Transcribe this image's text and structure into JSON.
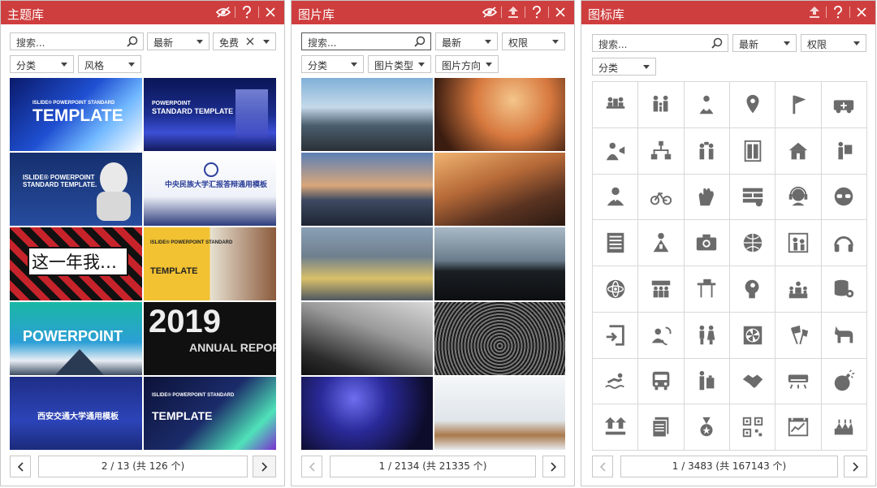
{
  "theme_panel": {
    "title": "主题库",
    "search_placeholder": "搜索...",
    "sort": "最新",
    "price": "免费",
    "category": "分类",
    "style": "风格",
    "tiles": [
      {
        "line1": "ISLIDE® POWERPOINT STANDARD",
        "line2": "TEMPLATE"
      },
      {
        "line1": "POWERPOINT",
        "line2": "STANDARD TEMPLATE"
      },
      {
        "line1": "ISLIDE® POWERPOINT",
        "line2": "STANDARD TEMPLATE."
      },
      {
        "line1": "中央民族大学汇报答辩通用模板",
        "line2": ""
      },
      {
        "line1": "这一年我…",
        "line2": ""
      },
      {
        "line1": "ISLIDE® POWERPOINT STANDARD",
        "line2": "TEMPLATE"
      },
      {
        "line1": "POWERPOINT",
        "line2": ""
      },
      {
        "line1": "2019",
        "line2": "ANNUAL REPORT"
      },
      {
        "line1": "西安交通大学通用模板",
        "line2": ""
      },
      {
        "line1": "ISLIDE® POWERPOINT STANDARD",
        "line2": "TEMPLATE"
      }
    ],
    "pager": "2 / 13 (共 126 个)"
  },
  "picture_panel": {
    "title": "图片库",
    "search_placeholder": "搜索...",
    "sort": "最新",
    "license": "权限",
    "category": "分类",
    "type": "图片类型",
    "orientation": "图片方向",
    "pager": "1 / 2134 (共 21335 个)"
  },
  "icon_panel": {
    "title": "图标库",
    "search_placeholder": "搜索...",
    "sort": "最新",
    "license": "权限",
    "category": "分类",
    "icons": [
      "meeting-icon",
      "family-icon",
      "user-target-icon",
      "location-pin-icon",
      "flag-icon",
      "ambulance-icon",
      "speaker-user-icon",
      "org-chart-icon",
      "group-talk-icon",
      "elevator-icon",
      "house-icon",
      "worker-board-icon",
      "doctor-icon",
      "bicycle-icon",
      "applause-icon",
      "brick-wall-icon",
      "support-agent-icon",
      "face-glasses-icon",
      "document-list-icon",
      "presenter-icon",
      "camera-icon",
      "globe-icon",
      "teacher-icon",
      "headphones-icon",
      "atom-icon",
      "team-icon",
      "desk-icon",
      "brain-idea-icon",
      "podium-icon",
      "database-gear-icon",
      "exit-icon",
      "user-cycle-icon",
      "couple-icon",
      "fan-icon",
      "flags-icon",
      "dog-icon",
      "swimmer-icon",
      "bus-icon",
      "person-luggage-icon",
      "handshake-icon",
      "air-conditioner-icon",
      "bomb-icon",
      "upload-icon",
      "documents-icon",
      "medal-icon",
      "qr-code-icon",
      "calendar-chart-icon",
      "cake-icon"
    ],
    "pager": "1 / 3483 (共 167143 个)"
  },
  "colors": {
    "title_bar": "#cf3e3e",
    "icon_fill": "#6b6b6b"
  }
}
